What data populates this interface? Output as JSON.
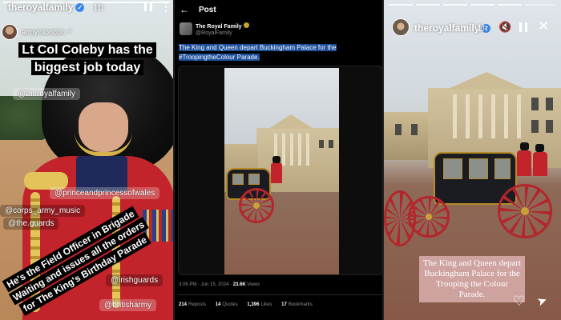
{
  "left_story": {
    "username": "theroyalfamily",
    "time": "1h",
    "more_icon": "more-icon",
    "reposted_from": "armyinlondon",
    "headline": "Lt Col Coleby has the biggest job today",
    "tags": {
      "theroyalfamily": "@theroyalfamily",
      "princeandprincess": "@princeandprincessofwales",
      "corps": "@corps_army_music",
      "guards": "@the.guards",
      "irishguards": "@irishguards",
      "britisharmy": "@britisharmy"
    },
    "rotated_caption": "He's the Field Officer in Brigade Waiting and issues all the orders for The King's Birthday Parade"
  },
  "x_post": {
    "back_icon": "←",
    "header": "Post",
    "account_name": "The Royal Family",
    "handle": "@RoyalFamily",
    "text": "The King and Queen depart Buckingham Palace for the #TroopingtheColour Parade.",
    "timestamp": "3:06 PM · Jun 15, 2024 · ",
    "views": "23.6K",
    "views_label": " Views",
    "stats": [
      {
        "value": "214",
        "label": "Reposts"
      },
      {
        "value": "14",
        "label": "Quotes"
      },
      {
        "value": "1,396",
        "label": "Likes"
      },
      {
        "value": "17",
        "label": "Bookmarks"
      }
    ]
  },
  "right_story": {
    "username": "theroyalfamily",
    "time": "1h",
    "mute_icon": "🔇",
    "close_icon": "✕",
    "caption": "The King and Queen depart Buckingham Palace for the Trooping the Colour Parade.",
    "heart_icon": "♡",
    "send_icon": "➤"
  },
  "colors": {
    "verified_blue": "#3b8df1",
    "x_highlight": "#1d4f9a",
    "tunic_red": "#c3232a",
    "caption_pink": "#deb2b2"
  }
}
